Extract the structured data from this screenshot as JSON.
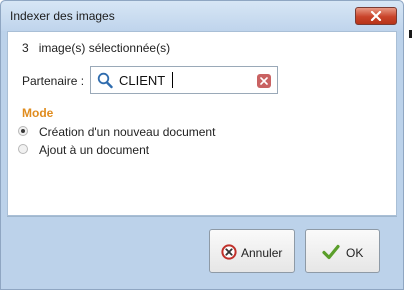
{
  "window": {
    "title": "Indexer des images"
  },
  "summary": {
    "count": "3",
    "text": "image(s) sélectionnée(s)"
  },
  "partner": {
    "label": "Partenaire :",
    "value": "CLIENT"
  },
  "mode": {
    "title": "Mode",
    "options": [
      {
        "label": "Création d'un nouveau document",
        "selected": true
      },
      {
        "label": "Ajout à un document",
        "selected": false
      }
    ]
  },
  "buttons": {
    "cancel": "Annuler",
    "ok": "OK"
  },
  "colors": {
    "section_title": "#e08c1e",
    "close_button": "#c9432a",
    "ok_check": "#5a9e2a",
    "cancel_icon": "#c0302a"
  },
  "icons": {
    "search": "magnifier-icon",
    "clear": "clear-x-icon",
    "close": "close-icon",
    "cancel": "cancel-icon",
    "ok": "checkmark-icon"
  }
}
